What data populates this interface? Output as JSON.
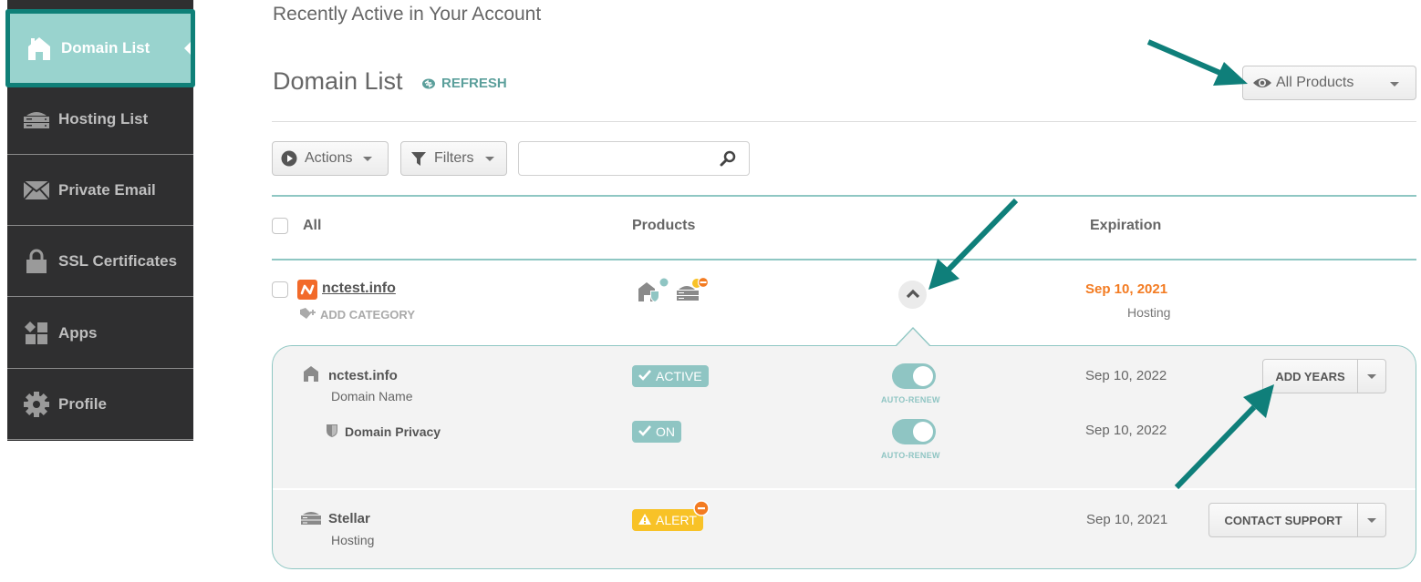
{
  "sidebar": {
    "items": [
      {
        "label": "Domain List",
        "icon": "home-icon",
        "active": true
      },
      {
        "label": "Hosting List",
        "icon": "server-icon",
        "active": false
      },
      {
        "label": "Private Email",
        "icon": "envelope-icon",
        "active": false
      },
      {
        "label": "SSL Certificates",
        "icon": "lock-icon",
        "active": false
      },
      {
        "label": "Apps",
        "icon": "apps-icon",
        "active": false
      },
      {
        "label": "Profile",
        "icon": "gear-icon",
        "active": false
      }
    ]
  },
  "header": {
    "recent_title": "Recently Active in Your Account",
    "page_title": "Domain List",
    "refresh_label": "REFRESH",
    "products_filter": {
      "icon": "eye-icon",
      "selected": "All Products"
    }
  },
  "toolbar": {
    "actions_label": "Actions",
    "filters_label": "Filters",
    "search": {
      "value": "",
      "placeholder": ""
    }
  },
  "table": {
    "columns": {
      "select_all": "All",
      "products": "Products",
      "expiration": "Expiration"
    },
    "rows": [
      {
        "domain": "nctest.info",
        "add_category_label": "ADD CATEGORY",
        "products_icons": [
          "domain-privacy-icon",
          "hosting-alert-icon"
        ],
        "expiration_date": "Sep 10, 2021",
        "expiration_type": "Hosting",
        "expanded": true,
        "details": [
          {
            "title": "nctest.info",
            "subtitle": "Domain Name",
            "status": "ACTIVE",
            "auto_renew": true,
            "auto_renew_label": "AUTO-RENEW",
            "expiration": "Sep 10, 2022",
            "action_label": "ADD YEARS"
          },
          {
            "title": "Domain Privacy",
            "subtitle": "",
            "status": "ON",
            "auto_renew": true,
            "auto_renew_label": "AUTO-RENEW",
            "expiration": "Sep 10, 2022"
          },
          {
            "title": "Stellar",
            "subtitle": "Hosting",
            "status": "ALERT",
            "expiration": "Sep 10, 2021",
            "action_label": "CONTACT SUPPORT"
          }
        ]
      }
    ]
  },
  "colors": {
    "accent_teal": "#0f8078",
    "active_bg": "#99d3ce",
    "status_teal": "#8fc5c3",
    "warning_orange": "#f37b21",
    "alert_yellow": "#f8c227",
    "sidebar_bg": "#2f2f30"
  }
}
